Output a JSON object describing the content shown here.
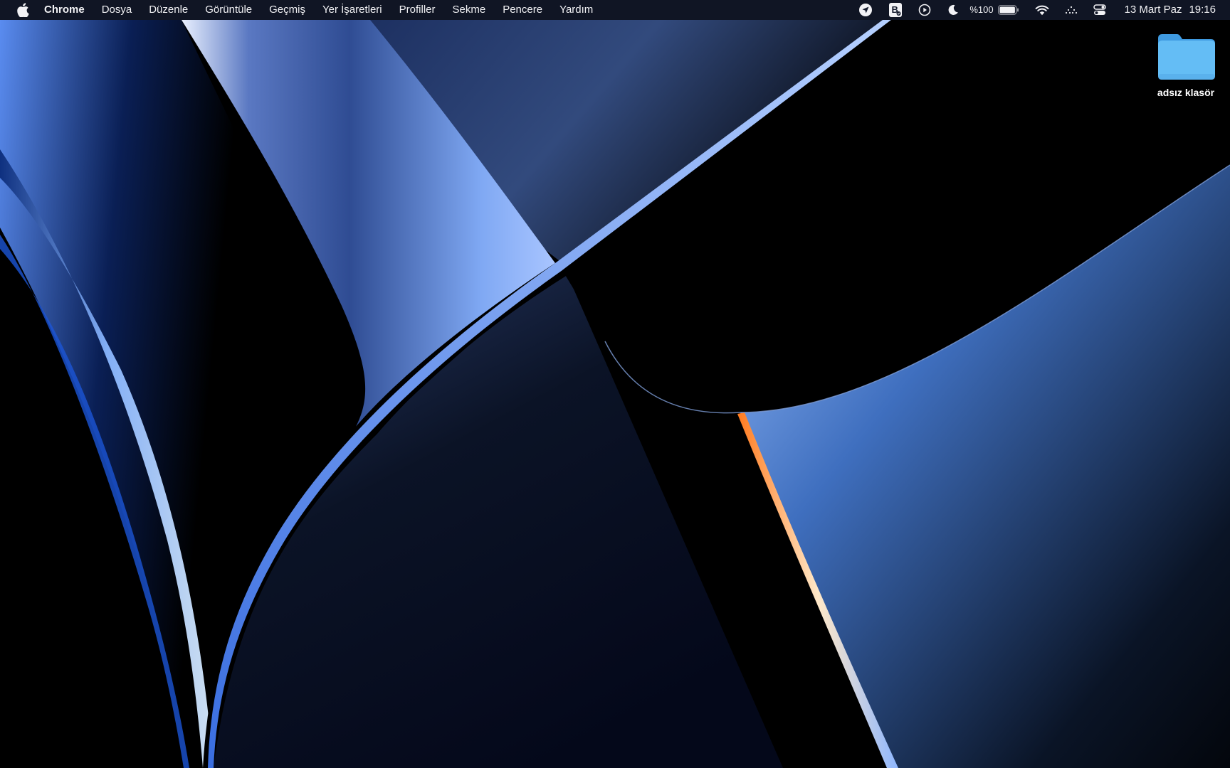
{
  "menubar": {
    "apple_icon": "apple-logo-icon",
    "app_name": "Chrome",
    "menus": [
      "Dosya",
      "Düzenle",
      "Görüntüle",
      "Geçmiş",
      "Yer İşaretleri",
      "Profiller",
      "Sekme",
      "Pencere",
      "Yardım"
    ],
    "status": {
      "icons": [
        "location-arrow-icon",
        "bitwarden-icon",
        "play-circle-icon",
        "moon-icon"
      ],
      "battery_percent": "%100",
      "battery_level": 1.0,
      "wifi_icon": "wifi-icon",
      "extra_icon": "dots-icon",
      "control_center_icon": "control-center-icon",
      "date": "13 Mart Paz",
      "time": "19:16"
    }
  },
  "desktop": {
    "folder": {
      "icon": "folder-icon",
      "label": "adsız klasör",
      "color": "#5ab4f2"
    }
  },
  "colors": {
    "menubar_bg": "#141a2c",
    "wallpaper_accent": "#4d86e6",
    "wallpaper_highlight": "#ff8a3c"
  }
}
